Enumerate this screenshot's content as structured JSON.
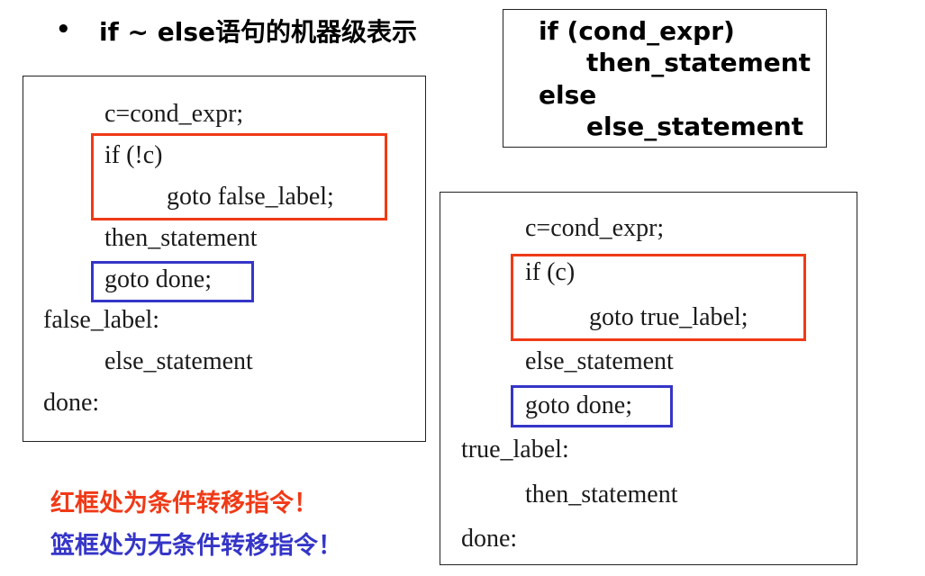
{
  "title": {
    "bullet": "•",
    "text": "if ~ else语句的机器级表示"
  },
  "syntax_box": {
    "lines": [
      "if (cond_expr)",
      "then_statement",
      "else",
      "else_statement"
    ]
  },
  "left_code": {
    "lines": [
      "c=cond_expr;",
      "if (!c)",
      "goto false_label;",
      "then_statement",
      "goto done;",
      "false_label:",
      "else_statement",
      "done:"
    ]
  },
  "right_code": {
    "lines": [
      "c=cond_expr;",
      "if (c)",
      "goto true_label;",
      "else_statement",
      "goto done;",
      "true_label:",
      "then_statement",
      "done:"
    ]
  },
  "notes": {
    "red_note": "红框处为条件转移指令！",
    "blue_note": "篮框处为无条件转移指令！"
  },
  "colors": {
    "red": "#f03a17",
    "blue": "#3535c8"
  }
}
